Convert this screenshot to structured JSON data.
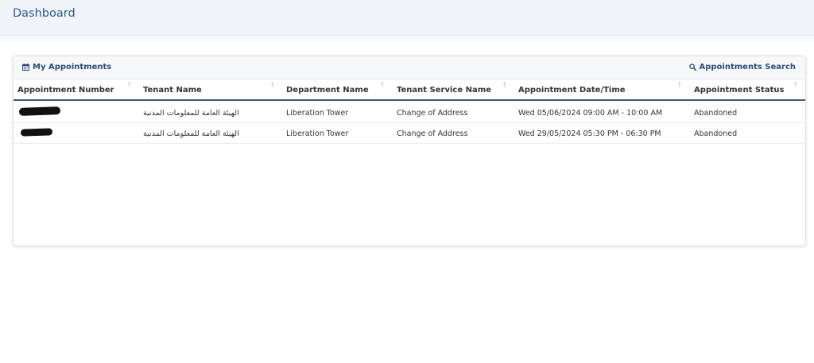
{
  "header": {
    "title": "Dashboard"
  },
  "panel": {
    "title": "My Appointments",
    "title_icon": "calendar-icon",
    "search_label": "Appointments Search",
    "search_icon": "search-icon"
  },
  "table": {
    "columns": [
      "Appointment Number",
      "Tenant Name",
      "Department Name",
      "Tenant Service Name",
      "Appointment Date/Time",
      "Appointment Status"
    ],
    "rows": [
      {
        "tenant": "الهيئة العامة للمعلومات المدنية",
        "department": "Liberation Tower",
        "service": "Change of Address",
        "datetime": "Wed 05/06/2024 09:00 AM - 10:00 AM",
        "status": "Abandoned"
      },
      {
        "tenant": "الهيئة العامة للمعلومات المدنية",
        "department": "Liberation Tower",
        "service": "Change of Address",
        "datetime": "Wed 29/05/2024 05:30 PM - 06:30 PM",
        "status": "Abandoned"
      }
    ]
  },
  "colors": {
    "accent": "#2b4c78",
    "title": "#2e5b8a",
    "header_rule": "#3c5a82"
  }
}
